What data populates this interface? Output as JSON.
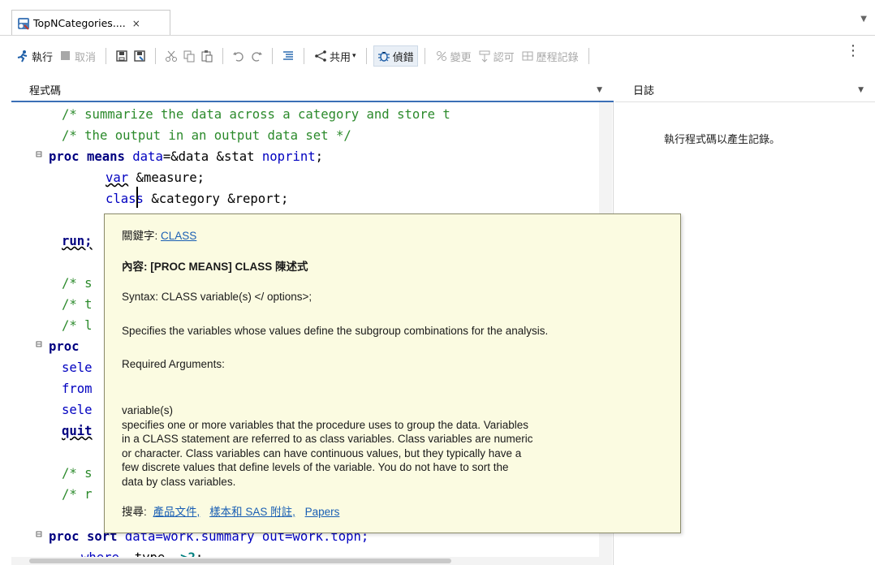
{
  "tab": {
    "label": "TopNCategories....",
    "close": "×"
  },
  "toolbar": {
    "run": "執行",
    "cancel": "取消",
    "share": "共用",
    "debug": "偵錯",
    "changes": "變更",
    "approve": "認可",
    "history": "歷程記錄"
  },
  "panes": {
    "code_title": "程式碼",
    "log_title": "日誌"
  },
  "log": {
    "message": "執行程式碼以產生記錄。"
  },
  "code": {
    "l1": "/* summarize the data across a category and store t",
    "l2": "/* the output in an output data set */",
    "l3_kw": "proc means",
    "l3_a": "data",
    "l3_b": "=&data &stat",
    "l3_c": "noprint",
    "l3_d": ";",
    "l4_kw": "var",
    "l4_b": " &measure;",
    "l5_kw": "class",
    "l5_b": " &category &report;",
    "l7_kw": "run;",
    "l8": "/* s",
    "l9": "/* t",
    "l10": "/* l",
    "l11_kw": "proc",
    "l12": "sele",
    "l13": "from",
    "l14": "sele",
    "l15_kw": "quit",
    "l16": "/* s",
    "l17": "/* r",
    "l18_kw": "proc sort",
    "l18_rest": " data=work.summary out=work.topn;",
    "l19_kw": "where",
    "l19_b": " _type_ ",
    "l19_c": ">2",
    "l19_d": ";"
  },
  "tooltip": {
    "keyword_label": "關鍵字:",
    "keyword_link": "CLASS",
    "context": "內容: [PROC MEANS] CLASS 陳述式",
    "syntax": "Syntax: CLASS variable(s) </ options>;",
    "summary": "Specifies the variables whose values define the subgroup combinations for the analysis.",
    "required": "Required Arguments:",
    "arg_desc": "variable(s)\nspecifies one or more variables that the procedure uses to group the data. Variables\nin a CLASS statement are referred to as class variables. Class variables are numeric\nor character. Class variables can have continuous values, but they typically have a\nfew discrete values that define levels of the variable. You do not have to sort the\ndata by class variables.",
    "search_label": "搜尋:",
    "search_links": [
      "產品文件,",
      "樣本和 SAS 附註,",
      "Papers"
    ]
  },
  "colors": {
    "comment": "#2b8a2b",
    "keyword": "#000080",
    "tooltip_bg": "#fbfbe1",
    "link": "#1a5fb4",
    "active_tab_underline": "#3b6fb6"
  }
}
